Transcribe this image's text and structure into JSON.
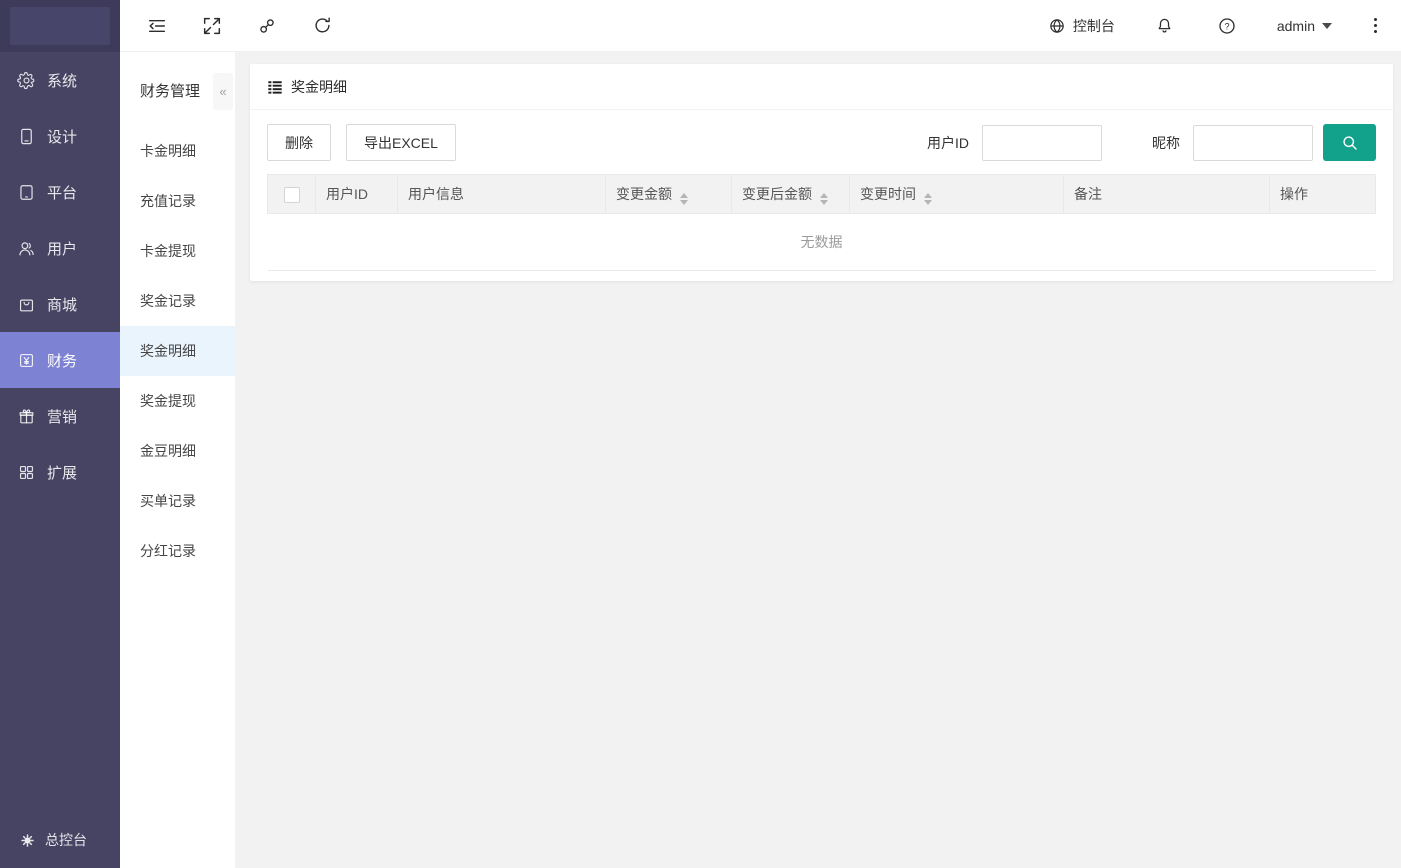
{
  "topbar": {
    "tools": [
      {
        "name": "menu-fold-icon"
      },
      {
        "name": "fullscreen-icon"
      },
      {
        "name": "link-icon"
      },
      {
        "name": "refresh-icon"
      }
    ],
    "console_label": "控制台",
    "admin_label": "admin"
  },
  "sidebar": {
    "items": [
      {
        "label": "系统",
        "icon": "gear-icon",
        "active": false
      },
      {
        "label": "设计",
        "icon": "design-device-icon",
        "active": false
      },
      {
        "label": "平台",
        "icon": "platform-device-icon",
        "active": false
      },
      {
        "label": "用户",
        "icon": "users-icon",
        "active": false
      },
      {
        "label": "商城",
        "icon": "mall-bag-icon",
        "active": false
      },
      {
        "label": "财务",
        "icon": "finance-yen-icon",
        "active": true
      },
      {
        "label": "营销",
        "icon": "gift-icon",
        "active": false
      },
      {
        "label": "扩展",
        "icon": "extension-grid-icon",
        "active": false
      }
    ],
    "footer_label": "总控台"
  },
  "submenu": {
    "title": "财务管理",
    "collapse_glyph": "«",
    "items": [
      {
        "label": "卡金明细",
        "active": false
      },
      {
        "label": "充值记录",
        "active": false
      },
      {
        "label": "卡金提现",
        "active": false
      },
      {
        "label": "奖金记录",
        "active": false
      },
      {
        "label": "奖金明细",
        "active": true
      },
      {
        "label": "奖金提现",
        "active": false
      },
      {
        "label": "金豆明细",
        "active": false
      },
      {
        "label": "买单记录",
        "active": false
      },
      {
        "label": "分红记录",
        "active": false
      }
    ]
  },
  "main": {
    "card_title": "奖金明细",
    "delete_button": "删除",
    "export_button": "导出EXCEL",
    "filter": {
      "user_id_label": "用户ID",
      "user_id_value": "",
      "nickname_label": "昵称",
      "nickname_value": ""
    },
    "table": {
      "columns": [
        {
          "label": "用户ID",
          "sortable": false
        },
        {
          "label": "用户信息",
          "sortable": false
        },
        {
          "label": "变更金额",
          "sortable": true
        },
        {
          "label": "变更后金额",
          "sortable": true
        },
        {
          "label": "变更时间",
          "sortable": true
        },
        {
          "label": "备注",
          "sortable": false
        },
        {
          "label": "操作",
          "sortable": false
        }
      ],
      "empty_text": "无数据"
    }
  },
  "colors": {
    "sidebar_bg": "#474463",
    "sidebar_active_bg": "#7e82d3",
    "submenu_active_bg": "#eaf4fd",
    "accent_teal": "#12a18b",
    "table_header_bg": "#f2f2f2",
    "content_bg": "#f2f2f3"
  }
}
